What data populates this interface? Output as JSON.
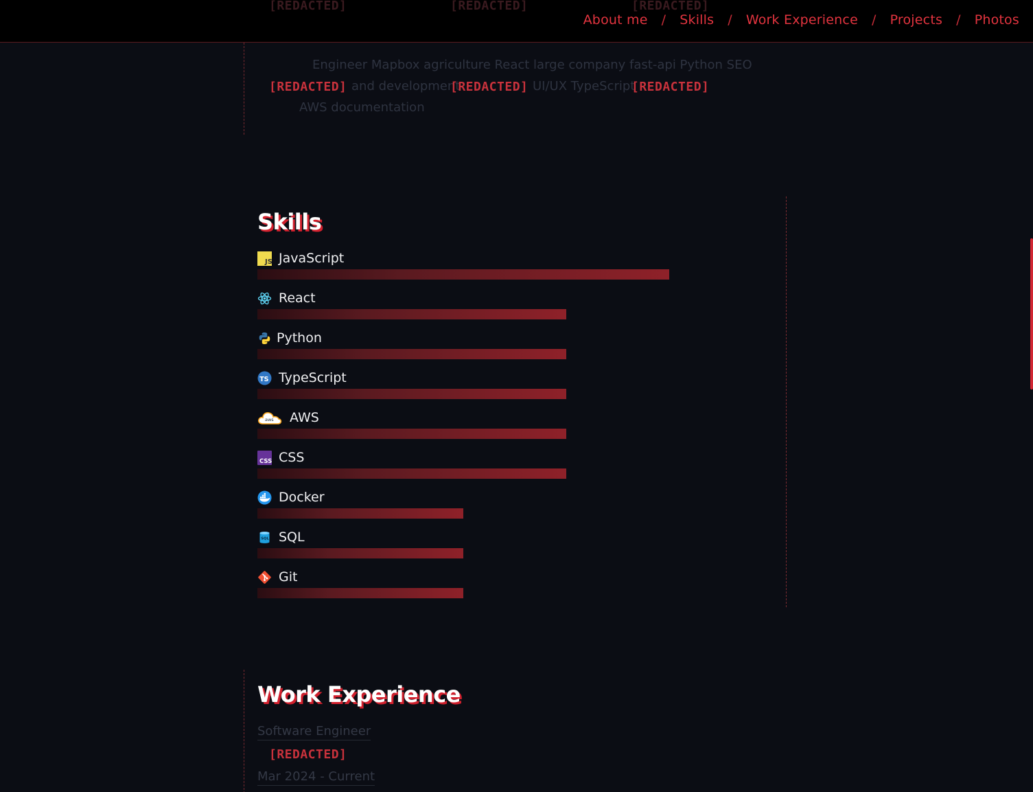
{
  "nav": {
    "items": [
      "About me",
      "Skills",
      "Work Experience",
      "Projects",
      "Photos"
    ],
    "separator": "/"
  },
  "redacted_label": "[REDACTED]",
  "about": {
    "lines": [
      "Engineer Mapbox agriculture React large company fast-api Python SEO",
      "and development",
      "UI/UX TypeScript",
      "AWS documentation"
    ]
  },
  "skills": {
    "title": "Skills",
    "items": [
      {
        "name": "JavaScript",
        "icon": "javascript-icon",
        "level": 0.857
      },
      {
        "name": "React",
        "icon": "react-icon",
        "level": 0.643
      },
      {
        "name": "Python",
        "icon": "python-icon",
        "level": 0.643
      },
      {
        "name": "TypeScript",
        "icon": "typescript-icon",
        "level": 0.643
      },
      {
        "name": "AWS",
        "icon": "aws-icon",
        "level": 0.643
      },
      {
        "name": "CSS",
        "icon": "css-icon",
        "level": 0.643
      },
      {
        "name": "Docker",
        "icon": "docker-icon",
        "level": 0.429
      },
      {
        "name": "SQL",
        "icon": "sql-icon",
        "level": 0.429
      },
      {
        "name": "Git",
        "icon": "git-icon",
        "level": 0.429
      }
    ]
  },
  "work": {
    "title": "Work Experience",
    "role": "Software Engineer",
    "dates": "Mar 2024 - Current"
  },
  "colors": {
    "accent": "#e3343f",
    "background": "#0b0d14",
    "bar_end": "#8f2129"
  }
}
